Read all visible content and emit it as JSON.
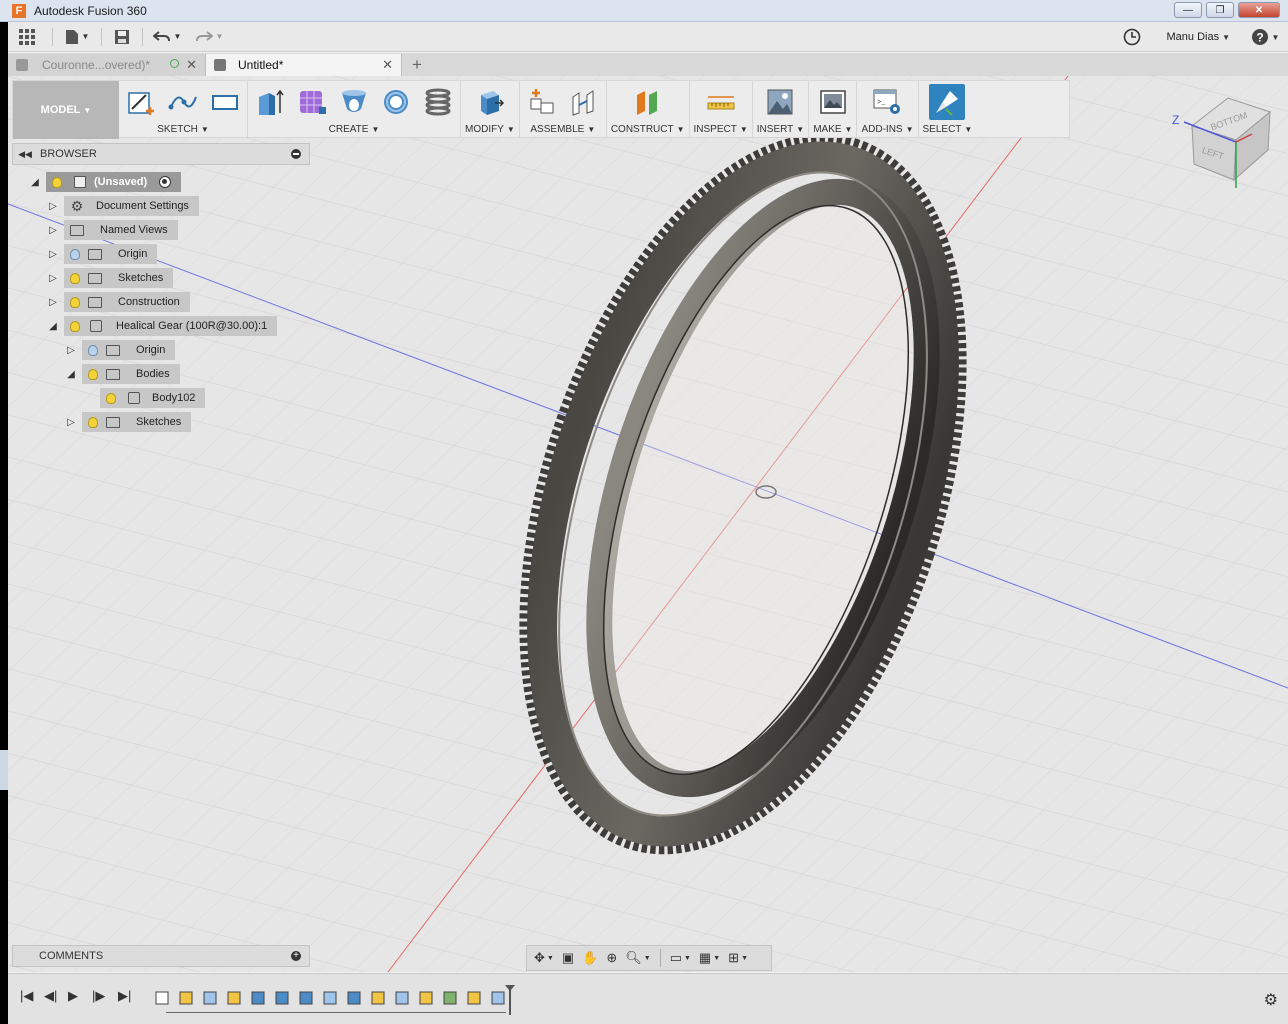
{
  "window": {
    "app_logo": "F",
    "title": "Autodesk Fusion 360",
    "buttons": {
      "minimize": "—",
      "maximize": "❐",
      "close": "✕"
    }
  },
  "appbar": {
    "user_name": "Manu Dias",
    "icons": [
      "grid-icon",
      "file-icon",
      "save-icon",
      "undo-icon",
      "redo-icon",
      "clock-icon",
      "help-icon"
    ]
  },
  "tabs": [
    {
      "label": "Couronne...overed)*",
      "active": false
    },
    {
      "label": "Untitled*",
      "active": true
    }
  ],
  "toolbar": {
    "workspace": "MODEL",
    "groups": [
      {
        "label": "SKETCH",
        "icons": [
          "create-sketch-icon",
          "spline-icon",
          "rectangle-icon"
        ]
      },
      {
        "label": "CREATE",
        "icons": [
          "extrude-icon",
          "form-icon",
          "hole-icon",
          "torus-icon",
          "coil-icon"
        ]
      },
      {
        "label": "MODIFY",
        "icons": [
          "press-pull-icon"
        ]
      },
      {
        "label": "ASSEMBLE",
        "icons": [
          "new-component-icon",
          "joint-icon"
        ]
      },
      {
        "label": "CONSTRUCT",
        "icons": [
          "offset-plane-icon"
        ]
      },
      {
        "label": "INSPECT",
        "icons": [
          "measure-icon"
        ]
      },
      {
        "label": "INSERT",
        "icons": [
          "insert-image-icon"
        ]
      },
      {
        "label": "MAKE",
        "icons": [
          "render-icon"
        ]
      },
      {
        "label": "ADD-INS",
        "icons": [
          "scripts-icon"
        ]
      },
      {
        "label": "SELECT",
        "icons": [
          "select-brush-icon"
        ]
      }
    ]
  },
  "browser": {
    "title": "BROWSER",
    "nodes": [
      {
        "label": "(Unsaved)"
      },
      {
        "label": "Document Settings"
      },
      {
        "label": "Named Views"
      },
      {
        "label": "Origin"
      },
      {
        "label": "Sketches"
      },
      {
        "label": "Construction"
      },
      {
        "label": "Healical Gear (100R@30.00):1"
      },
      {
        "label": "Origin"
      },
      {
        "label": "Bodies"
      },
      {
        "label": "Body102"
      },
      {
        "label": "Sketches"
      }
    ]
  },
  "comments": {
    "title": "COMMENTS"
  },
  "viewcube": {
    "face_top": "BOTTOM",
    "face_left": "LEFT",
    "axis_z": "Z"
  },
  "navbar": {
    "icons": [
      "orbit-icon",
      "look-at-icon",
      "pan-icon",
      "zoom-icon",
      "fit-icon",
      "display-icon",
      "grid-settings-icon",
      "viewports-icon"
    ]
  },
  "timeline": {
    "controls": [
      "first-icon",
      "prev-icon",
      "play-icon",
      "next-icon",
      "last-icon"
    ],
    "features": 15
  }
}
